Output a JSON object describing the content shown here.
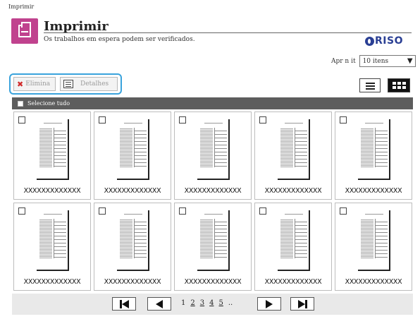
{
  "breadcrumb": "Imprimir",
  "header": {
    "title": "Imprimir",
    "subtitle": "Os trabalhos em espera podem ser verificados.",
    "logo_text": "RISO",
    "accent_color": "#c0428e",
    "logo_color": "#2a3f94"
  },
  "per_page": {
    "label": "Apr n it",
    "value": "10 itens"
  },
  "toolbar": {
    "delete_label": "Elimina",
    "details_label": "Detalhes"
  },
  "select_all_label": "Selecione tudo",
  "jobs": [
    {
      "name": "XXXXXXXXXXXXX"
    },
    {
      "name": "XXXXXXXXXXXXX"
    },
    {
      "name": "XXXXXXXXXXXXX"
    },
    {
      "name": "XXXXXXXXXXXXX"
    },
    {
      "name": "XXXXXXXXXXXXX"
    },
    {
      "name": "XXXXXXXXXXXXX"
    },
    {
      "name": "XXXXXXXXXXXXX"
    },
    {
      "name": "XXXXXXXXXXXXX"
    },
    {
      "name": "XXXXXXXXXXXXX"
    },
    {
      "name": "XXXXXXXXXXXXX"
    }
  ],
  "pagination": {
    "pages": [
      "1",
      "2",
      "3",
      "4",
      "5"
    ],
    "ellipsis": "..",
    "current": "1"
  }
}
